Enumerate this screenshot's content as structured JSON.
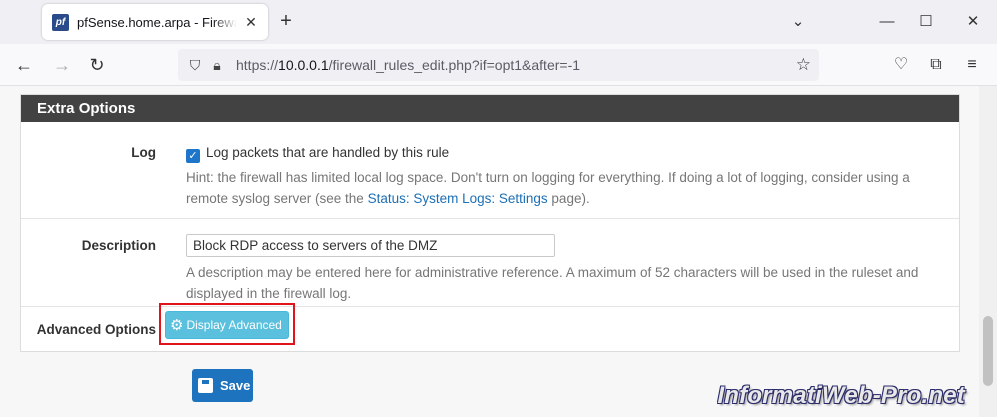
{
  "browser": {
    "tab_title": "pfSense.home.arpa - Firewall: Rules: Edit",
    "favicon_text": "pf",
    "close_tab_glyph": "✕",
    "new_tab_glyph": "+",
    "minimize_glyph": "—",
    "maximize_glyph": "☐",
    "close_glyph": "✕",
    "dropdown_glyph": "⌄",
    "url_prefix": "https://",
    "url_host": "10.0.0.1",
    "url_path": "/firewall_rules_edit.php?if=opt1&after=-1"
  },
  "panel": {
    "heading": "Extra Options",
    "log": {
      "label": "Log",
      "checkbox_label": "Log packets that are handled by this rule",
      "checked": true,
      "hint_before": "Hint: the firewall has limited local log space. Don't turn on logging for everything. If doing a lot of logging, consider using a remote syslog server (see the ",
      "hint_link": "Status: System Logs: Settings",
      "hint_after": " page)."
    },
    "description": {
      "label": "Description",
      "value": "Block RDP access to servers of the DMZ",
      "hint": "A description may be entered here for administrative reference. A maximum of 52 characters will be used in the ruleset and displayed in the firewall log."
    },
    "advanced": {
      "label": "Advanced Options",
      "button_label": "Display Advanced"
    }
  },
  "actions": {
    "save_label": "Save"
  },
  "watermark": "InformatiWeb-Pro.net",
  "colors": {
    "panel_header": "#424242",
    "info_button": "#5bc0de",
    "primary_button": "#1e73be",
    "highlight_box": "#e0141a",
    "link": "#1c6fb4"
  }
}
